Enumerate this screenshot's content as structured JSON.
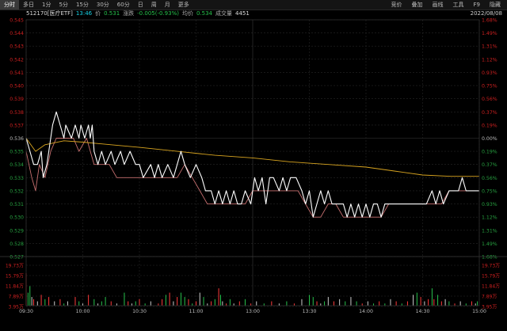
{
  "toolbar": {
    "tabs": [
      "分时",
      "多日",
      "1分",
      "5分",
      "15分",
      "30分",
      "60分",
      "日",
      "周",
      "月",
      "更多"
    ],
    "right": [
      "竞价",
      "叠加",
      "画线",
      "工具",
      "F9",
      "隐藏"
    ]
  },
  "info": {
    "code": "512170[医疗ETF]",
    "time": "13:46",
    "price_label": "价",
    "price": "0.531",
    "change_label": "涨跌",
    "change": "-0.005(-0.93%)",
    "avg_label": "均价",
    "avg": "0.534",
    "volume_label": "成交量",
    "volume": "4451",
    "date": "2022/08/08"
  },
  "colors": {
    "up": "#ff3b3b",
    "down": "#27c24c",
    "flat": "#cccccc",
    "price_line": "#ffffff",
    "avg_line": "#d9a520",
    "lag_line": "#c87070",
    "grid": "#262626",
    "axis_text": "#cc2020"
  },
  "chart_data": {
    "type": "line",
    "prev_close": 0.536,
    "y_left_ticks": [
      "0.545",
      "0.544",
      "0.543",
      "0.542",
      "0.541",
      "0.540",
      "0.539",
      "0.538",
      "0.537",
      "0.536",
      "0.535",
      "0.534",
      "0.533",
      "0.532",
      "0.531",
      "0.530",
      "0.529",
      "0.528",
      "0.527"
    ],
    "y_right_ticks": [
      "1.68%",
      "1.49%",
      "1.31%",
      "1.12%",
      "0.93%",
      "0.75%",
      "0.56%",
      "0.37%",
      "0.19%",
      "0.00%",
      "0.19%",
      "0.37%",
      "0.56%",
      "0.75%",
      "0.93%",
      "1.12%",
      "1.31%",
      "1.49%",
      "1.68%"
    ],
    "x_ticks": [
      "09:30",
      "10:00",
      "10:30",
      "11:00",
      "13:00",
      "13:30",
      "14:00",
      "14:30",
      "15:00"
    ],
    "volume_ticks": [
      "19.73万",
      "15.79万",
      "11.84万",
      "7.89万",
      "3.95万"
    ],
    "price_series": [
      [
        0,
        0.536
      ],
      [
        2,
        0.535
      ],
      [
        4,
        0.534
      ],
      [
        6,
        0.534
      ],
      [
        8,
        0.535
      ],
      [
        9,
        0.533
      ],
      [
        11,
        0.534
      ],
      [
        14,
        0.537
      ],
      [
        16,
        0.538
      ],
      [
        18,
        0.537
      ],
      [
        20,
        0.536
      ],
      [
        21,
        0.537
      ],
      [
        24,
        0.536
      ],
      [
        26,
        0.537
      ],
      [
        28,
        0.536
      ],
      [
        29,
        0.537
      ],
      [
        31,
        0.536
      ],
      [
        33,
        0.537
      ],
      [
        34,
        0.536
      ],
      [
        35,
        0.537
      ],
      [
        36,
        0.535
      ],
      [
        38,
        0.534
      ],
      [
        40,
        0.535
      ],
      [
        42,
        0.534
      ],
      [
        45,
        0.535
      ],
      [
        47,
        0.534
      ],
      [
        50,
        0.535
      ],
      [
        52,
        0.534
      ],
      [
        55,
        0.535
      ],
      [
        58,
        0.534
      ],
      [
        60,
        0.534
      ],
      [
        62,
        0.533
      ],
      [
        66,
        0.534
      ],
      [
        68,
        0.533
      ],
      [
        70,
        0.534
      ],
      [
        72,
        0.533
      ],
      [
        75,
        0.534
      ],
      [
        78,
        0.533
      ],
      [
        80,
        0.534
      ],
      [
        82,
        0.535
      ],
      [
        84,
        0.534
      ],
      [
        87,
        0.533
      ],
      [
        90,
        0.534
      ],
      [
        93,
        0.533
      ],
      [
        95,
        0.532
      ],
      [
        98,
        0.532
      ],
      [
        100,
        0.531
      ],
      [
        102,
        0.532
      ],
      [
        104,
        0.531
      ],
      [
        106,
        0.532
      ],
      [
        108,
        0.531
      ],
      [
        110,
        0.532
      ],
      [
        112,
        0.531
      ],
      [
        114,
        0.531
      ],
      [
        116,
        0.532
      ],
      [
        119,
        0.531
      ],
      [
        121,
        0.533
      ],
      [
        123,
        0.532
      ],
      [
        125,
        0.533
      ],
      [
        127,
        0.531
      ],
      [
        129,
        0.533
      ],
      [
        131,
        0.533
      ],
      [
        134,
        0.532
      ],
      [
        136,
        0.533
      ],
      [
        138,
        0.532
      ],
      [
        140,
        0.533
      ],
      [
        143,
        0.533
      ],
      [
        146,
        0.532
      ],
      [
        148,
        0.531
      ],
      [
        150,
        0.532
      ],
      [
        152,
        0.53
      ],
      [
        154,
        0.531
      ],
      [
        156,
        0.532
      ],
      [
        158,
        0.531
      ],
      [
        160,
        0.532
      ],
      [
        162,
        0.531
      ],
      [
        164,
        0.531
      ],
      [
        168,
        0.531
      ],
      [
        170,
        0.53
      ],
      [
        172,
        0.531
      ],
      [
        174,
        0.53
      ],
      [
        176,
        0.531
      ],
      [
        178,
        0.53
      ],
      [
        180,
        0.531
      ],
      [
        182,
        0.53
      ],
      [
        184,
        0.531
      ],
      [
        186,
        0.531
      ],
      [
        188,
        0.53
      ],
      [
        190,
        0.531
      ],
      [
        193,
        0.531
      ],
      [
        196,
        0.531
      ],
      [
        199,
        0.531
      ],
      [
        203,
        0.531
      ],
      [
        206,
        0.531
      ],
      [
        209,
        0.531
      ],
      [
        212,
        0.531
      ],
      [
        215,
        0.532
      ],
      [
        217,
        0.531
      ],
      [
        219,
        0.532
      ],
      [
        221,
        0.531
      ],
      [
        224,
        0.532
      ],
      [
        226,
        0.532
      ],
      [
        229,
        0.532
      ],
      [
        231,
        0.533
      ],
      [
        233,
        0.532
      ],
      [
        236,
        0.532
      ],
      [
        238,
        0.532
      ],
      [
        240,
        0.532
      ]
    ],
    "avg_series": [
      [
        0,
        0.536
      ],
      [
        5,
        0.535
      ],
      [
        10,
        0.5355
      ],
      [
        20,
        0.5358
      ],
      [
        30,
        0.5357
      ],
      [
        45,
        0.5355
      ],
      [
        60,
        0.5353
      ],
      [
        80,
        0.535
      ],
      [
        100,
        0.5347
      ],
      [
        120,
        0.5345
      ],
      [
        140,
        0.5342
      ],
      [
        160,
        0.534
      ],
      [
        180,
        0.5338
      ],
      [
        195,
        0.5335
      ],
      [
        210,
        0.5332
      ],
      [
        225,
        0.5331
      ],
      [
        240,
        0.5331
      ]
    ],
    "lag_series": [
      [
        0,
        0.535
      ],
      [
        3,
        0.533
      ],
      [
        5,
        0.532
      ],
      [
        7,
        0.534
      ],
      [
        10,
        0.533
      ],
      [
        13,
        0.535
      ],
      [
        16,
        0.536
      ],
      [
        19,
        0.536
      ],
      [
        22,
        0.536
      ],
      [
        25,
        0.536
      ],
      [
        28,
        0.535
      ],
      [
        32,
        0.536
      ],
      [
        36,
        0.534
      ],
      [
        40,
        0.534
      ],
      [
        44,
        0.534
      ],
      [
        48,
        0.533
      ],
      [
        52,
        0.533
      ],
      [
        56,
        0.533
      ],
      [
        60,
        0.533
      ],
      [
        64,
        0.533
      ],
      [
        68,
        0.533
      ],
      [
        72,
        0.533
      ],
      [
        76,
        0.533
      ],
      [
        80,
        0.533
      ],
      [
        84,
        0.534
      ],
      [
        88,
        0.533
      ],
      [
        92,
        0.532
      ],
      [
        96,
        0.531
      ],
      [
        100,
        0.531
      ],
      [
        104,
        0.531
      ],
      [
        108,
        0.531
      ],
      [
        112,
        0.531
      ],
      [
        116,
        0.531
      ],
      [
        120,
        0.532
      ],
      [
        124,
        0.532
      ],
      [
        128,
        0.532
      ],
      [
        132,
        0.532
      ],
      [
        136,
        0.532
      ],
      [
        140,
        0.532
      ],
      [
        144,
        0.532
      ],
      [
        148,
        0.531
      ],
      [
        152,
        0.53
      ],
      [
        156,
        0.53
      ],
      [
        160,
        0.531
      ],
      [
        164,
        0.531
      ],
      [
        168,
        0.53
      ],
      [
        172,
        0.53
      ],
      [
        176,
        0.53
      ],
      [
        180,
        0.53
      ],
      [
        184,
        0.53
      ],
      [
        188,
        0.53
      ],
      [
        192,
        0.531
      ],
      [
        196,
        0.531
      ],
      [
        200,
        0.531
      ],
      [
        204,
        0.531
      ],
      [
        208,
        0.531
      ],
      [
        212,
        0.531
      ],
      [
        216,
        0.531
      ],
      [
        220,
        0.531
      ],
      [
        224,
        0.532
      ],
      [
        228,
        0.532
      ],
      [
        232,
        0.532
      ],
      [
        236,
        0.532
      ],
      [
        240,
        0.532
      ]
    ],
    "volume_max": 19.73,
    "volume_bars": [
      [
        0,
        15,
        "up"
      ],
      [
        1,
        6,
        "down"
      ],
      [
        2,
        9,
        "down"
      ],
      [
        3,
        4,
        "flat"
      ],
      [
        4,
        3,
        "up"
      ],
      [
        6,
        2,
        "flat"
      ],
      [
        8,
        5,
        "up"
      ],
      [
        10,
        3,
        "down"
      ],
      [
        12,
        4,
        "up"
      ],
      [
        15,
        2,
        "flat"
      ],
      [
        18,
        3,
        "up"
      ],
      [
        20,
        1,
        "down"
      ],
      [
        22,
        2,
        "flat"
      ],
      [
        26,
        4,
        "up"
      ],
      [
        28,
        2,
        "down"
      ],
      [
        30,
        1,
        "flat"
      ],
      [
        33,
        5,
        "up"
      ],
      [
        36,
        3,
        "down"
      ],
      [
        38,
        1,
        "flat"
      ],
      [
        40,
        2,
        "down"
      ],
      [
        42,
        4,
        "down"
      ],
      [
        45,
        2,
        "up"
      ],
      [
        48,
        1,
        "flat"
      ],
      [
        52,
        6,
        "down"
      ],
      [
        54,
        2,
        "up"
      ],
      [
        56,
        1,
        "flat"
      ],
      [
        58,
        2,
        "down"
      ],
      [
        60,
        3,
        "up"
      ],
      [
        63,
        1,
        "down"
      ],
      [
        66,
        2,
        "flat"
      ],
      [
        70,
        1,
        "up"
      ],
      [
        72,
        3,
        "up"
      ],
      [
        74,
        5,
        "down"
      ],
      [
        76,
        6,
        "up"
      ],
      [
        78,
        2,
        "flat"
      ],
      [
        80,
        4,
        "up"
      ],
      [
        82,
        6,
        "down"
      ],
      [
        84,
        4,
        "down"
      ],
      [
        86,
        3,
        "up"
      ],
      [
        88,
        1,
        "down"
      ],
      [
        90,
        2,
        "up"
      ],
      [
        92,
        6,
        "flat"
      ],
      [
        94,
        4,
        "down"
      ],
      [
        96,
        1,
        "flat"
      ],
      [
        98,
        2,
        "up"
      ],
      [
        100,
        3,
        "down"
      ],
      [
        102,
        8,
        "up"
      ],
      [
        103,
        5,
        "down"
      ],
      [
        104,
        2,
        "flat"
      ],
      [
        106,
        1,
        "up"
      ],
      [
        108,
        3,
        "down"
      ],
      [
        110,
        1,
        "flat"
      ],
      [
        113,
        2,
        "up"
      ],
      [
        116,
        3,
        "down"
      ],
      [
        119,
        1,
        "up"
      ],
      [
        122,
        2,
        "flat"
      ],
      [
        126,
        1,
        "down"
      ],
      [
        130,
        2,
        "up"
      ],
      [
        134,
        1,
        "flat"
      ],
      [
        138,
        2,
        "down"
      ],
      [
        142,
        1,
        "up"
      ],
      [
        146,
        3,
        "flat"
      ],
      [
        150,
        5,
        "down"
      ],
      [
        152,
        4,
        "down"
      ],
      [
        154,
        2,
        "up"
      ],
      [
        156,
        1,
        "flat"
      ],
      [
        158,
        2,
        "down"
      ],
      [
        160,
        4,
        "flat"
      ],
      [
        163,
        2,
        "up"
      ],
      [
        166,
        3,
        "flat"
      ],
      [
        169,
        2,
        "down"
      ],
      [
        172,
        4,
        "flat"
      ],
      [
        175,
        2,
        "down"
      ],
      [
        178,
        1,
        "up"
      ],
      [
        181,
        2,
        "flat"
      ],
      [
        184,
        1,
        "down"
      ],
      [
        187,
        2,
        "up"
      ],
      [
        190,
        1,
        "down"
      ],
      [
        193,
        3,
        "flat"
      ],
      [
        196,
        2,
        "up"
      ],
      [
        199,
        1,
        "down"
      ],
      [
        202,
        2,
        "up"
      ],
      [
        205,
        5,
        "flat"
      ],
      [
        207,
        6,
        "down"
      ],
      [
        209,
        4,
        "up"
      ],
      [
        211,
        2,
        "flat"
      ],
      [
        213,
        3,
        "up"
      ],
      [
        215,
        8,
        "down"
      ],
      [
        216,
        3,
        "up"
      ],
      [
        218,
        5,
        "down"
      ],
      [
        220,
        2,
        "up"
      ],
      [
        222,
        3,
        "flat"
      ],
      [
        224,
        2,
        "down"
      ],
      [
        227,
        1,
        "up"
      ],
      [
        230,
        2,
        "flat"
      ],
      [
        233,
        1,
        "down"
      ],
      [
        236,
        2,
        "up"
      ],
      [
        238,
        1,
        "flat"
      ],
      [
        239,
        2,
        "down"
      ]
    ]
  }
}
